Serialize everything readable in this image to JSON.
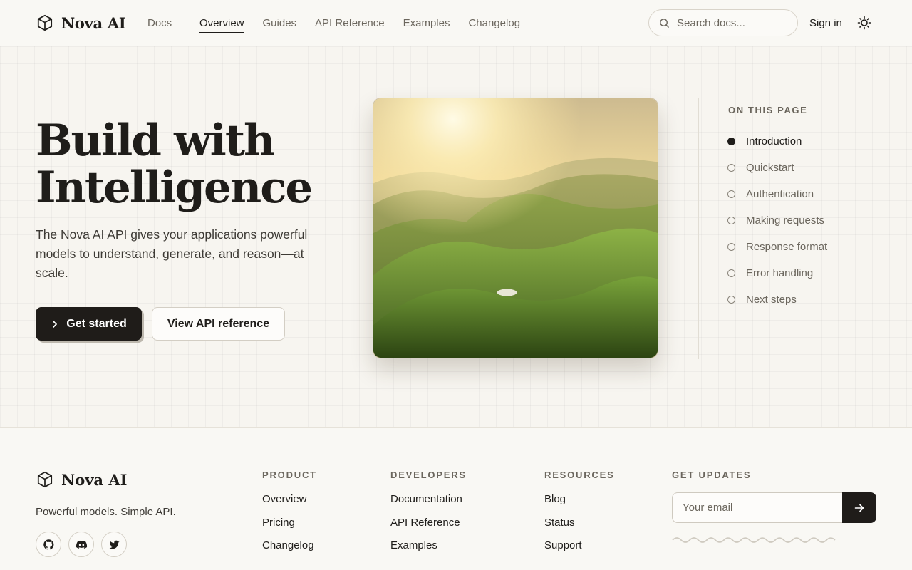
{
  "header": {
    "brand": "Nova AI",
    "brand_icon": "cube-icon",
    "section": "Docs",
    "nav": [
      {
        "label": "Overview",
        "active": true
      },
      {
        "label": "Guides"
      },
      {
        "label": "API Reference"
      },
      {
        "label": "Examples"
      },
      {
        "label": "Changelog"
      }
    ],
    "search_placeholder": "Search docs...",
    "signin": "Sign in",
    "theme_icon": "sun-icon"
  },
  "hero": {
    "title_line1": "Build with",
    "title_line2": "Intelligence",
    "description": "The Nova AI API gives your applications powerful models to understand, generate, and reason—at scale.",
    "primary_cta": "Get started",
    "secondary_cta": "View API reference",
    "image": "sunlit-green-hills-landscape"
  },
  "toc": {
    "heading": "ON THIS PAGE",
    "items": [
      {
        "label": "Introduction",
        "active": true
      },
      {
        "label": "Quickstart"
      },
      {
        "label": "Authentication"
      },
      {
        "label": "Making requests"
      },
      {
        "label": "Response format"
      },
      {
        "label": "Error handling"
      },
      {
        "label": "Next steps"
      }
    ]
  },
  "footer": {
    "brand": "Nova AI",
    "tagline": "Powerful models. Simple API.",
    "socials": [
      "github-icon",
      "discord-icon",
      "twitter-icon"
    ],
    "columns": [
      {
        "title": "PRODUCT",
        "links": [
          "Overview",
          "Pricing",
          "Changelog"
        ]
      },
      {
        "title": "DEVELOPERS",
        "links": [
          "Documentation",
          "API Reference",
          "Examples"
        ]
      },
      {
        "title": "RESOURCES",
        "links": [
          "Blog",
          "Status",
          "Support"
        ]
      }
    ],
    "updates_title": "GET UPDATES",
    "email_placeholder": "Your email"
  },
  "colors": {
    "background": "#f7f5f0",
    "text": "#1f1d1a",
    "muted": "#6b665d",
    "primary_button": "#1f1c19",
    "border": "#d9d4ca"
  }
}
